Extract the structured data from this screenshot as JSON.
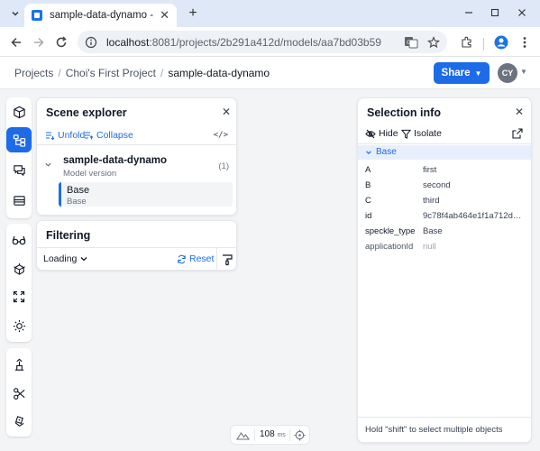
{
  "browser": {
    "tab_title": "sample-data-dynamo - Choi's",
    "url_host": "localhost",
    "url_path": ":8081/projects/2b291a412d/models/aa7bd03b59"
  },
  "header": {
    "breadcrumbs": [
      "Projects",
      "Choi's First Project",
      "sample-data-dynamo"
    ],
    "share_label": "Share",
    "avatar_initials": "CY",
    "accent_color": "#1e6be8"
  },
  "toolbar": {
    "icons": [
      "cube-icon",
      "scene-tree-icon",
      "comments-icon",
      "views-icon",
      "glasses-icon",
      "explode-icon",
      "fullscreen-icon",
      "light-icon",
      "measure-icon",
      "scissors-icon",
      "dice-icon"
    ],
    "active": "scene-tree-icon"
  },
  "scene_explorer": {
    "title": "Scene explorer",
    "unfold_label": "Unfold",
    "collapse_label": "Collapse",
    "code_label": "</>",
    "model_name": "sample-data-dynamo",
    "model_sub": "Model version",
    "model_count": "(1)",
    "object_name": "Base",
    "object_sub": "Base"
  },
  "filtering": {
    "title": "Filtering",
    "select_value": "Loading",
    "reset_label": "Reset"
  },
  "selection_info": {
    "title": "Selection info",
    "hide_label": "Hide",
    "isolate_label": "Isolate",
    "group_label": "Base",
    "properties": [
      {
        "key": "A",
        "value": "first"
      },
      {
        "key": "B",
        "value": "second"
      },
      {
        "key": "C",
        "value": "third"
      },
      {
        "key": "id",
        "value": "9c78f4ab464e1f1a712d82..."
      },
      {
        "key": "speckle_type",
        "value": "Base"
      },
      {
        "key": "applicationId",
        "value": "null"
      }
    ],
    "hint": "Hold \"shift\" to select multiple objects"
  },
  "perf": {
    "ms_value": "108",
    "ms_unit": "ms"
  }
}
